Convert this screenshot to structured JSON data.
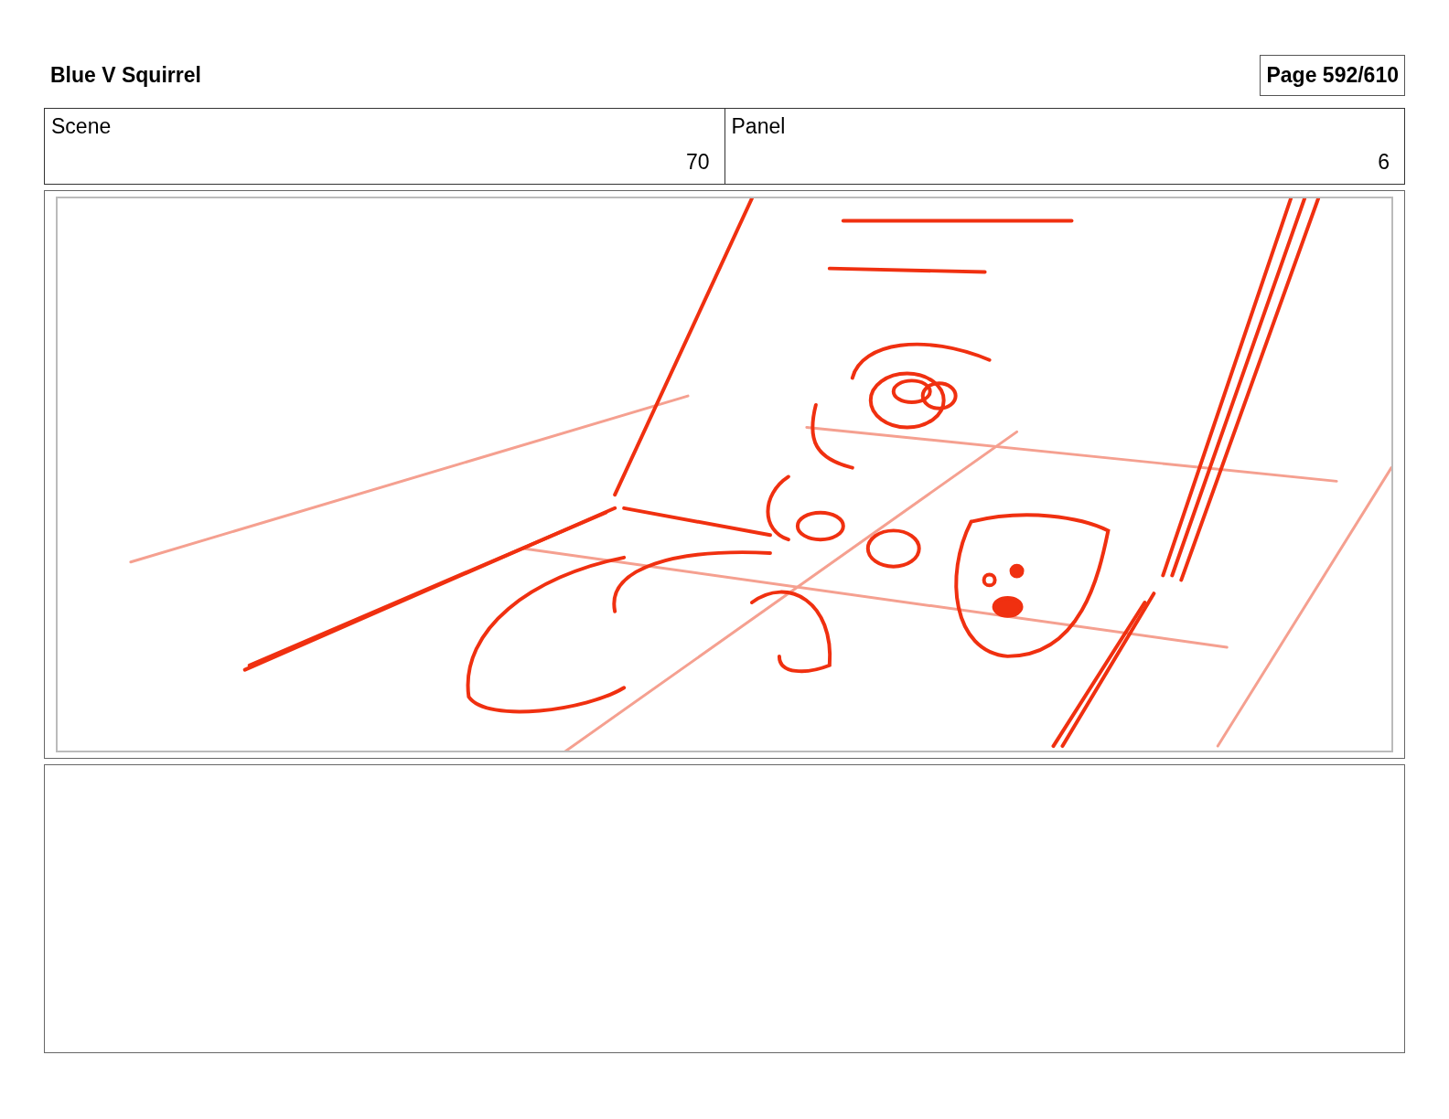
{
  "title": "Blue V Squirrel",
  "page": "Page 592/610",
  "fields": [
    {
      "label": "Scene",
      "value": "70"
    },
    {
      "label": "Panel",
      "value": "6"
    }
  ]
}
